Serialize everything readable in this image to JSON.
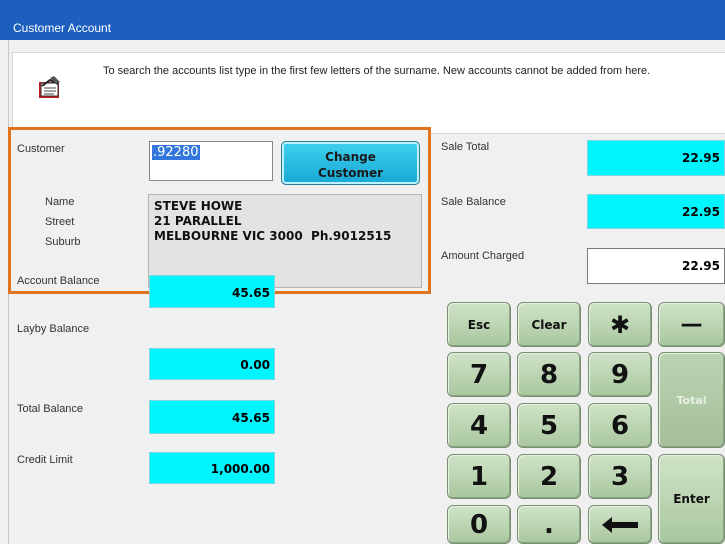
{
  "window": {
    "title": "Customer Account"
  },
  "info": {
    "text": "To search the accounts list type in the first few letters of the surname.  New accounts cannot be added from here."
  },
  "customer": {
    "label": "Customer",
    "value": ".92280",
    "change_button": "Change Customer",
    "change_line1": "Change",
    "change_line2": "Customer",
    "name_label": "Name",
    "street_label": "Street",
    "suburb_label": "Suburb",
    "name": "STEVE HOWE",
    "street": "21 PARALLEL",
    "suburb": "MELBOURNE VIC 3000  Ph.9012515"
  },
  "balances": {
    "account_label": "Account Balance",
    "account_value": "45.65",
    "layby_label": "Layby Balance",
    "layby_value": "0.00",
    "total_label": "Total Balance",
    "total_value": "45.65",
    "credit_label": "Credit Limit",
    "credit_value": "1,000.00"
  },
  "sale": {
    "total_label": "Sale Total",
    "total_value": "22.95",
    "balance_label": "Sale Balance",
    "balance_value": "22.95",
    "charged_label": "Amount Charged",
    "charged_value": "22.95"
  },
  "keypad": {
    "esc": "Esc",
    "clear": "Clear",
    "multiply": "✱",
    "minus": "—",
    "k7": "7",
    "k8": "8",
    "k9": "9",
    "total": "Total",
    "k4": "4",
    "k5": "5",
    "k6": "6",
    "k1": "1",
    "k2": "2",
    "k3": "3",
    "enter": "Enter",
    "k0": "0",
    "dot": "."
  },
  "colors": {
    "accent_orange": "#e0731e",
    "cyan_field": "#00f5ff",
    "titlebar": "#1d5fbf",
    "key_green": "#b8d4ae"
  }
}
